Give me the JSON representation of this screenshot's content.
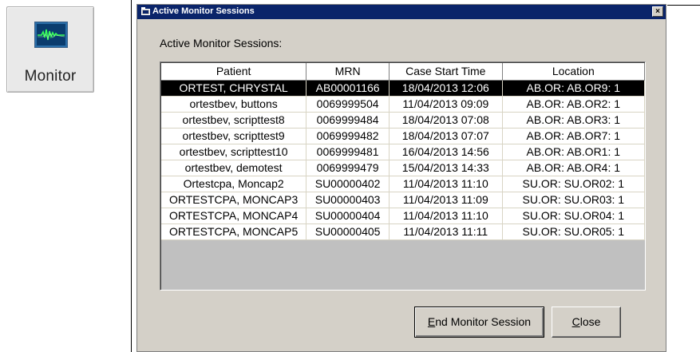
{
  "toolbar": {
    "monitor_label": "Monitor"
  },
  "dialog": {
    "title": "Active Monitor Sessions",
    "close_glyph": "×",
    "heading": "Active Monitor Sessions:",
    "columns": [
      "Patient",
      "MRN",
      "Case Start Time",
      "Location"
    ],
    "rows": [
      {
        "patient": "ORTEST, CHRYSTAL",
        "mrn": "AB00001166",
        "start": "18/04/2013 12:06",
        "location": "AB.OR: AB.OR9: 1",
        "selected": true
      },
      {
        "patient": "ortestbev, buttons",
        "mrn": "0069999504",
        "start": "11/04/2013 09:09",
        "location": "AB.OR: AB.OR2: 1"
      },
      {
        "patient": "ortestbev, scripttest8",
        "mrn": "0069999484",
        "start": "18/04/2013 07:08",
        "location": "AB.OR: AB.OR3: 1"
      },
      {
        "patient": "ortestbev, scripttest9",
        "mrn": "0069999482",
        "start": "18/04/2013 07:07",
        "location": "AB.OR: AB.OR7: 1"
      },
      {
        "patient": "ortestbev, scripttest10",
        "mrn": "0069999481",
        "start": "16/04/2013 14:56",
        "location": "AB.OR: AB.OR1: 1"
      },
      {
        "patient": "ortestbev, demotest",
        "mrn": "0069999479",
        "start": "15/04/2013 14:33",
        "location": "AB.OR: AB.OR4: 1"
      },
      {
        "patient": "Ortestcpa, Moncap2",
        "mrn": "SU00000402",
        "start": "11/04/2013 11:10",
        "location": "SU.OR: SU.OR02: 1"
      },
      {
        "patient": "ORTESTCPA, MONCAP3",
        "mrn": "SU00000403",
        "start": "11/04/2013 11:09",
        "location": "SU.OR: SU.OR03: 1"
      },
      {
        "patient": "ORTESTCPA, MONCAP4",
        "mrn": "SU00000404",
        "start": "11/04/2013 11:10",
        "location": "SU.OR: SU.OR04: 1"
      },
      {
        "patient": "ORTESTCPA, MONCAP5",
        "mrn": "SU00000405",
        "start": "11/04/2013 11:11",
        "location": "SU.OR: SU.OR05: 1"
      }
    ],
    "buttons": {
      "end_first": "E",
      "end_rest": "nd Monitor Session",
      "close_first": "C",
      "close_rest": "lose"
    }
  },
  "colors": {
    "title_bar": "#0a246a",
    "dialog_bg": "#d4d0c8",
    "selected_row_bg": "#000000",
    "selected_row_text": "#ffffff"
  },
  "icons": {
    "monitor": "waveform-monitor-icon",
    "title": "app-window-icon",
    "close": "close-icon"
  }
}
